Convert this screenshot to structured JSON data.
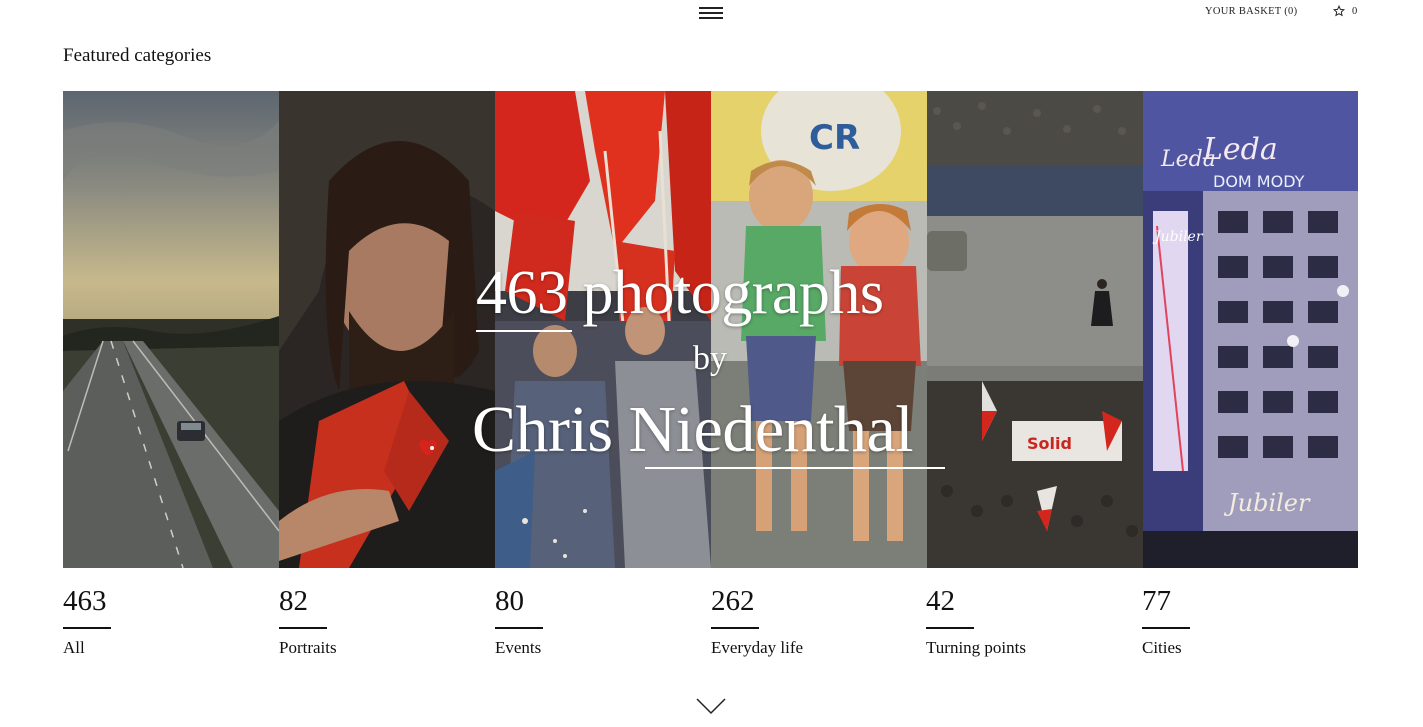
{
  "header": {
    "basket_label": "YOUR BASKET (0)",
    "favourites_count": "0",
    "menu_icon": "hamburger-menu-icon",
    "favourites_icon": "star-icon"
  },
  "section_title": "Featured categories",
  "hero": {
    "line1": "463 photographs",
    "line2": "by",
    "line3": "Chris Niedenthal"
  },
  "categories": [
    {
      "count": "463",
      "label": "All"
    },
    {
      "count": "82",
      "label": "Portraits"
    },
    {
      "count": "80",
      "label": "Events"
    },
    {
      "count": "262",
      "label": "Everyday life"
    },
    {
      "count": "42",
      "label": "Turning points"
    },
    {
      "count": "77",
      "label": "Cities"
    }
  ],
  "scroll_icon": "chevron-down-icon"
}
